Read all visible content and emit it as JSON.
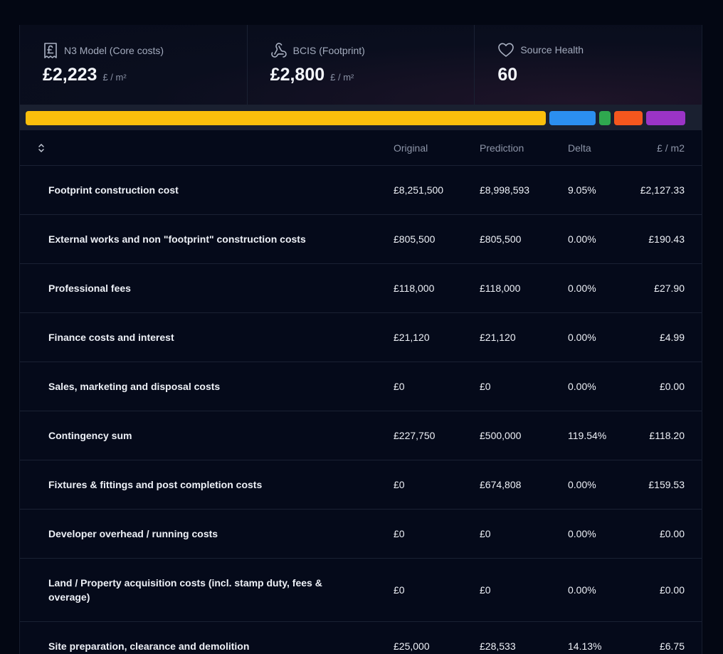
{
  "cards": [
    {
      "title": "N3 Model (Core costs)",
      "value": "£2,223",
      "unit": "£ / m²",
      "icon": "receipt-pound-icon"
    },
    {
      "title": "BCIS (Footprint)",
      "value": "£2,800",
      "unit": "£ / m²",
      "icon": "webhook-icon"
    },
    {
      "title": "Source Health",
      "value": "60",
      "unit": "",
      "icon": "heart-icon"
    }
  ],
  "bar_segments": [
    {
      "color": "#fbbf0c",
      "share": 0.7926
    },
    {
      "color": "#2b8ff0",
      "share": 0.0712
    },
    {
      "color": "#2fa84f",
      "share": 0.0166
    },
    {
      "color": "#f5571e",
      "share": 0.0432
    },
    {
      "color": "#9b34c6",
      "share": 0.0605
    }
  ],
  "table": {
    "columns": {
      "original": "Original",
      "prediction": "Prediction",
      "delta": "Delta",
      "per_m2": "£ / m2"
    },
    "rows": [
      {
        "name": "Footprint construction cost",
        "original": "£8,251,500",
        "prediction": "£8,998,593",
        "delta": "9.05%",
        "per_m2": "£2,127.33"
      },
      {
        "name": "External works and non \"footprint\" construction costs",
        "original": "£805,500",
        "prediction": "£805,500",
        "delta": "0.00%",
        "per_m2": "£190.43"
      },
      {
        "name": "Professional fees",
        "original": "£118,000",
        "prediction": "£118,000",
        "delta": "0.00%",
        "per_m2": "£27.90"
      },
      {
        "name": "Finance costs and interest",
        "original": "£21,120",
        "prediction": "£21,120",
        "delta": "0.00%",
        "per_m2": "£4.99"
      },
      {
        "name": "Sales, marketing and disposal costs",
        "original": "£0",
        "prediction": "£0",
        "delta": "0.00%",
        "per_m2": "£0.00"
      },
      {
        "name": "Contingency sum",
        "original": "£227,750",
        "prediction": "£500,000",
        "delta": "119.54%",
        "per_m2": "£118.20"
      },
      {
        "name": "Fixtures & fittings and post completion costs",
        "original": "£0",
        "prediction": "£674,808",
        "delta": "0.00%",
        "per_m2": "£159.53"
      },
      {
        "name": "Developer overhead / running costs",
        "original": "£0",
        "prediction": "£0",
        "delta": "0.00%",
        "per_m2": "£0.00"
      },
      {
        "name": "Land / Property acquisition costs (incl. stamp duty, fees & overage)",
        "original": "£0",
        "prediction": "£0",
        "delta": "0.00%",
        "per_m2": "£0.00"
      },
      {
        "name": "Site preparation, clearance and demolition",
        "original": "£25,000",
        "prediction": "£28,533",
        "delta": "14.13%",
        "per_m2": "£6.75"
      }
    ]
  }
}
